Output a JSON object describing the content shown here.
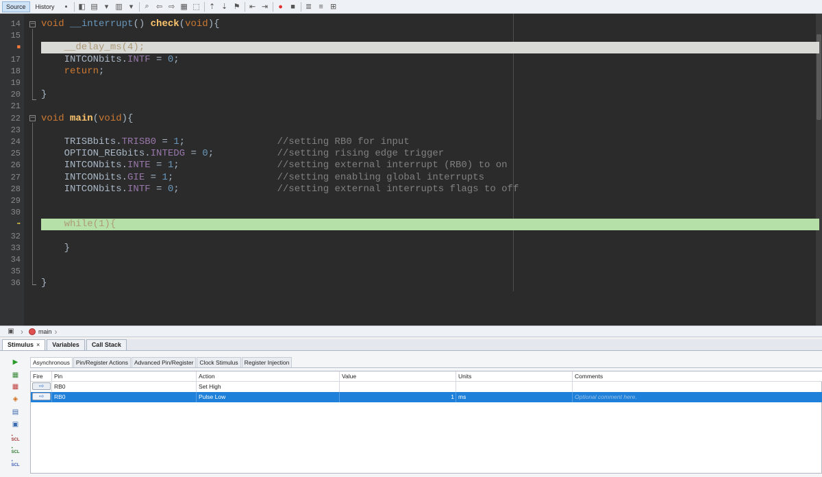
{
  "toolbar": {
    "tabs": [
      "Source",
      "History"
    ],
    "icons": [
      "go-to-last-edit-icon",
      "forward-icon",
      "back-icon",
      "find-selection-icon",
      "find-previous-icon",
      "find-next-icon",
      "toggle-highlight-icon",
      "toggle-rectangular-selection-icon",
      "previous-bookmark-icon",
      "next-bookmark-icon",
      "toggle-bookmark-icon",
      "shift-left-icon",
      "shift-right-icon",
      "start-macro-recording-icon",
      "stop-macro-recording-icon",
      "comment-icon",
      "uncomment-icon"
    ]
  },
  "editor": {
    "lines": [
      {
        "n": "14",
        "code": [
          [
            "kw",
            "void "
          ],
          [
            "intr",
            "__interrupt"
          ],
          [
            "plain",
            "() "
          ],
          [
            "fn",
            "check"
          ],
          [
            "plain",
            "("
          ],
          [
            "kw",
            "void"
          ],
          [
            "plain",
            "){"
          ]
        ]
      },
      {
        "n": "15",
        "code": []
      },
      {
        "n": "16",
        "marker": "breakpoint",
        "highlight": "gray",
        "code": [
          [
            "dim",
            "    __delay_ms(4);"
          ]
        ]
      },
      {
        "n": "17",
        "code": [
          [
            "plain",
            "    INTCONbits."
          ],
          [
            "field",
            "INTF"
          ],
          [
            "plain",
            " = "
          ],
          [
            "num",
            "0"
          ],
          [
            "plain",
            ";"
          ]
        ]
      },
      {
        "n": "18",
        "code": [
          [
            "kw",
            "    return"
          ],
          [
            "plain",
            ";"
          ]
        ]
      },
      {
        "n": "19",
        "code": []
      },
      {
        "n": "20",
        "code": [
          [
            "plain",
            "}"
          ]
        ]
      },
      {
        "n": "21",
        "code": []
      },
      {
        "n": "22",
        "code": [
          [
            "kw",
            "void "
          ],
          [
            "fn",
            "main"
          ],
          [
            "plain",
            "("
          ],
          [
            "kw",
            "void"
          ],
          [
            "plain",
            "){"
          ]
        ]
      },
      {
        "n": "23",
        "code": []
      },
      {
        "n": "24",
        "code": [
          [
            "plain",
            "    TRISBbits."
          ],
          [
            "field",
            "TRISB0"
          ],
          [
            "plain",
            " = "
          ],
          [
            "num",
            "1"
          ],
          [
            "plain",
            ";                "
          ],
          [
            "cm",
            "//setting RB0 for input"
          ]
        ]
      },
      {
        "n": "25",
        "code": [
          [
            "plain",
            "    OPTION_REGbits."
          ],
          [
            "field",
            "INTEDG"
          ],
          [
            "plain",
            " = "
          ],
          [
            "num",
            "0"
          ],
          [
            "plain",
            ";           "
          ],
          [
            "cm",
            "//setting rising edge trigger"
          ]
        ]
      },
      {
        "n": "26",
        "code": [
          [
            "plain",
            "    INTCONbits."
          ],
          [
            "field",
            "INTE"
          ],
          [
            "plain",
            " = "
          ],
          [
            "num",
            "1"
          ],
          [
            "plain",
            ";                 "
          ],
          [
            "cm",
            "//setting external interrupt (RB0) to on"
          ]
        ]
      },
      {
        "n": "27",
        "code": [
          [
            "plain",
            "    INTCONbits."
          ],
          [
            "field",
            "GIE"
          ],
          [
            "plain",
            " = "
          ],
          [
            "num",
            "1"
          ],
          [
            "plain",
            ";                  "
          ],
          [
            "cm",
            "//setting enabling global interrupts"
          ]
        ]
      },
      {
        "n": "28",
        "code": [
          [
            "plain",
            "    INTCONbits."
          ],
          [
            "field",
            "INTF"
          ],
          [
            "plain",
            " = "
          ],
          [
            "num",
            "0"
          ],
          [
            "plain",
            ";                 "
          ],
          [
            "cm",
            "//setting external interrupts flags to off"
          ]
        ]
      },
      {
        "n": "29",
        "code": []
      },
      {
        "n": "30",
        "code": []
      },
      {
        "n": "31",
        "marker": "pc",
        "highlight": "green",
        "code": [
          [
            "dim",
            "    while(1){"
          ]
        ]
      },
      {
        "n": "32",
        "code": []
      },
      {
        "n": "33",
        "code": [
          [
            "plain",
            "    }"
          ]
        ]
      },
      {
        "n": "34",
        "code": []
      },
      {
        "n": "35",
        "code": []
      },
      {
        "n": "36",
        "code": [
          [
            "plain",
            "}"
          ]
        ]
      }
    ]
  },
  "breadcrumb": {
    "function": "main"
  },
  "panel": {
    "tabs": [
      {
        "label": "Stimulus",
        "close": "×"
      },
      {
        "label": "Variables"
      },
      {
        "label": "Call Stack"
      }
    ],
    "sub_tabs": [
      "Asynchronous",
      "Pin/Register Actions",
      "Advanced Pin/Register",
      "Clock Stimulus",
      "Register Injection"
    ],
    "columns": [
      "Fire",
      "Pin",
      "Action",
      "Value",
      "Units",
      "Comments"
    ],
    "rows": [
      {
        "pin": "RB0",
        "action": "Set High",
        "value": "",
        "units": "",
        "comment": "",
        "selected": false
      },
      {
        "pin": "RB0",
        "action": "Pulse Low",
        "value": "1",
        "units": "ms",
        "comment": "Optional comment here.",
        "selected": true
      }
    ],
    "side_icons": [
      "apply-synchronous-stimulus-icon",
      "add-row-icon",
      "delete-row-icon",
      "clear-icon",
      "open-icon",
      "save-icon",
      "scl-icon",
      "scl-open-icon",
      "scl-save-icon"
    ]
  }
}
